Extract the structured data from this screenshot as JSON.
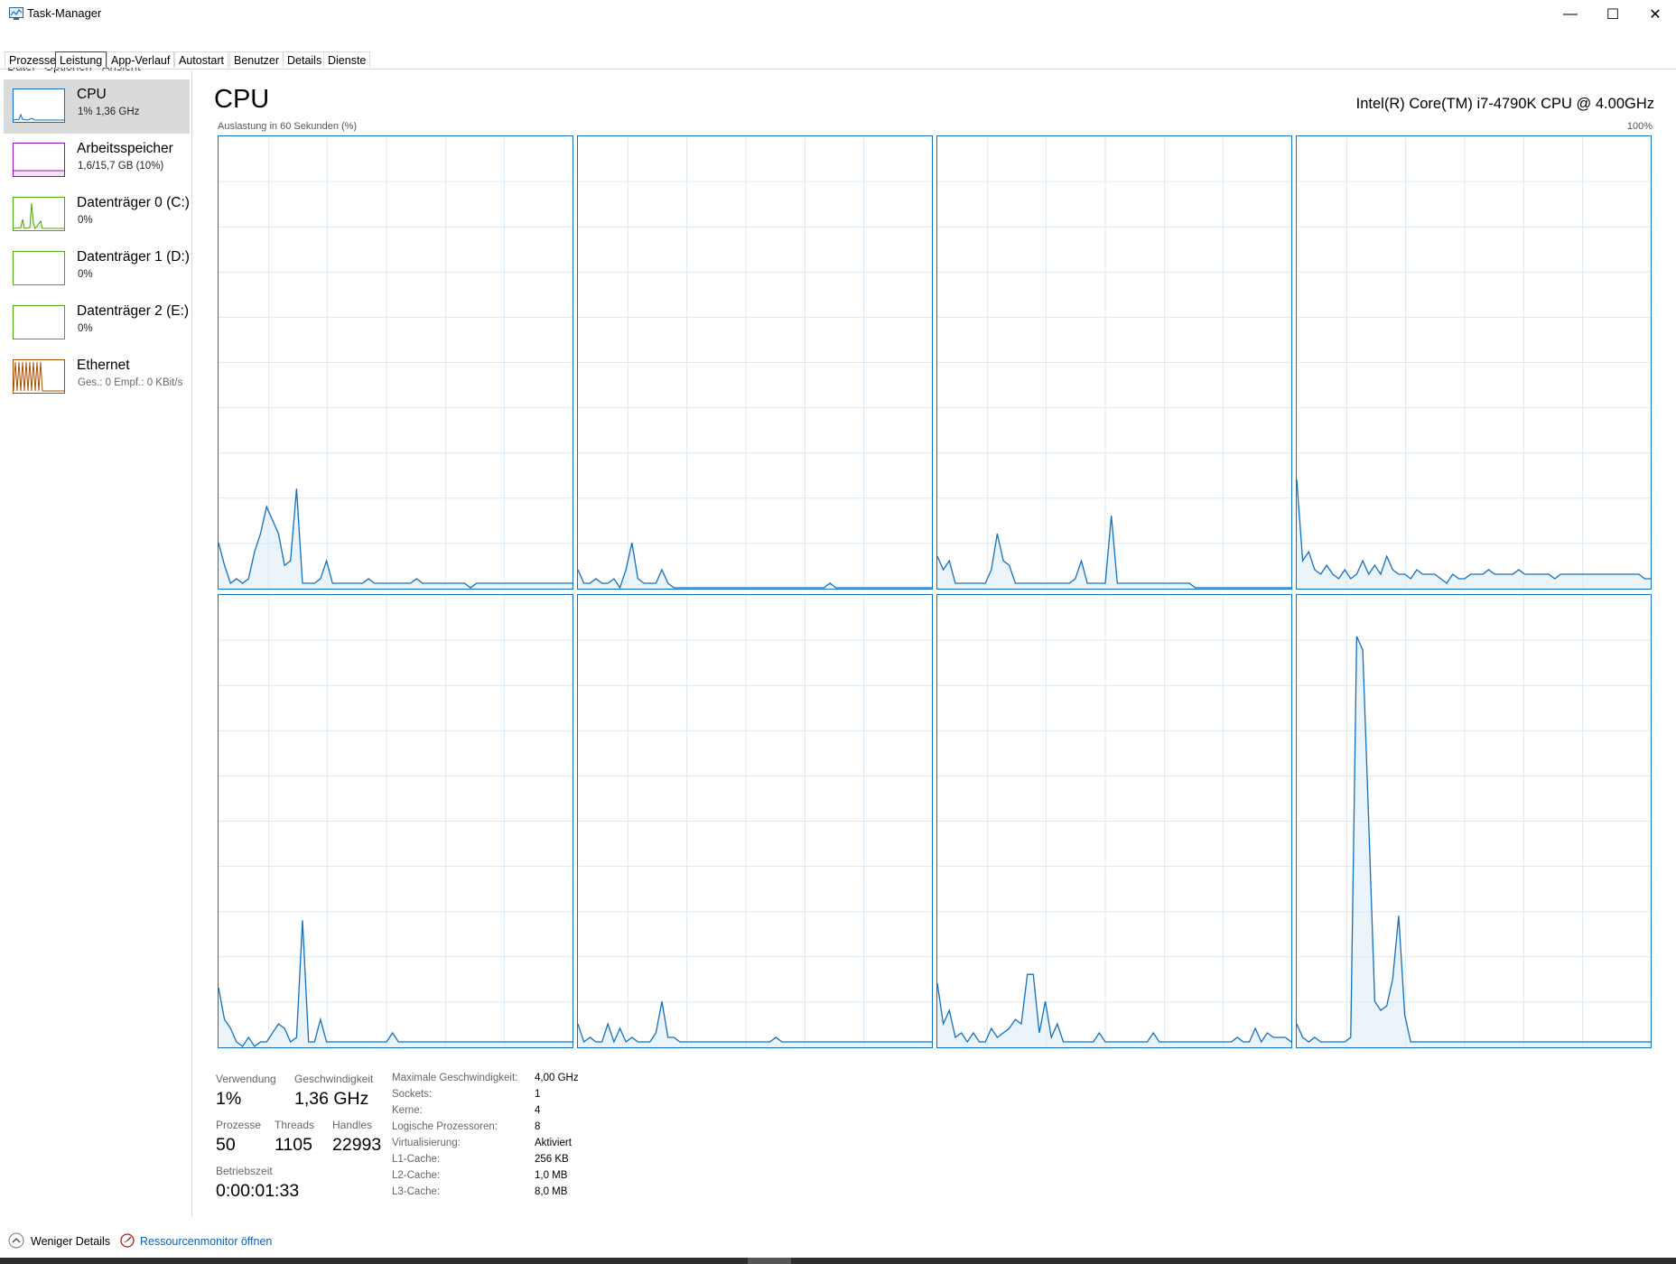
{
  "window": {
    "title": "Task-Manager",
    "minimize": "—",
    "maximize": "☐",
    "close": "✕"
  },
  "menu": [
    "Datei",
    "Optionen",
    "Ansicht"
  ],
  "tabs": [
    {
      "label": "Prozesse",
      "active": false
    },
    {
      "label": "Leistung",
      "active": true
    },
    {
      "label": "App-Verlauf",
      "active": false
    },
    {
      "label": "Autostart",
      "active": false
    },
    {
      "label": "Benutzer",
      "active": false
    },
    {
      "label": "Details",
      "active": false
    },
    {
      "label": "Dienste",
      "active": false
    }
  ],
  "sidebar": {
    "items": [
      {
        "title": "CPU",
        "subtitle": "1%  1,36 GHz",
        "color": "#1170c0",
        "selected": true
      },
      {
        "title": "Arbeitsspeicher",
        "subtitle": "1,6/15,7 GB (10%)",
        "color": "#8b12ae",
        "selected": false
      },
      {
        "title": "Datenträger 0 (C:)",
        "subtitle": "0%",
        "color": "#4da60c",
        "selected": false
      },
      {
        "title": "Datenträger 1 (D:)",
        "subtitle": "0%",
        "color": "#4da60c",
        "selected": false
      },
      {
        "title": "Datenträger 2 (E:)",
        "subtitle": "0%",
        "color": "#4da60c",
        "selected": false
      },
      {
        "title": "Ethernet",
        "subtitle": "Ges.: 0 Empf.: 0 KBit/s",
        "color": "#a74f01",
        "selected": false
      }
    ]
  },
  "main": {
    "title": "CPU",
    "cpu_model": "Intel(R) Core(TM) i7-4790K CPU @ 4.00GHz",
    "graph_label": "Auslastung in 60 Sekunden (%)",
    "graph_max": "100%",
    "accent": "#1170c0",
    "grid_color": "#d9eaf7"
  },
  "chart_data": {
    "type": "area",
    "title": "",
    "xlabel": "",
    "ylabel": "Auslastung in 60 Sekunden (%)",
    "ylim": [
      0,
      100
    ],
    "xlim": [
      0,
      60
    ],
    "grid": true,
    "series": [
      {
        "name": "",
        "values": [
          10,
          5,
          1,
          2,
          1,
          2,
          8,
          12,
          18,
          15,
          12,
          5,
          6,
          22,
          1,
          1,
          1,
          2,
          6,
          1,
          1,
          1,
          1,
          1,
          1,
          2,
          1,
          1,
          1,
          1,
          1,
          1,
          1,
          2,
          1,
          1,
          1,
          1,
          1,
          1,
          1,
          1,
          0,
          1,
          1,
          1,
          1,
          1,
          1,
          1,
          1,
          1,
          1,
          1,
          1,
          1,
          1,
          1,
          1,
          1
        ]
      },
      {
        "name": "",
        "values": [
          4,
          1,
          1,
          2,
          1,
          1,
          2,
          0,
          4,
          10,
          2,
          1,
          1,
          1,
          4,
          1,
          0,
          0,
          0,
          0,
          0,
          0,
          0,
          0,
          0,
          0,
          0,
          0,
          0,
          0,
          0,
          0,
          0,
          0,
          0,
          0,
          0,
          0,
          0,
          0,
          0,
          0,
          1,
          0,
          0,
          0,
          0,
          0,
          0,
          0,
          0,
          0,
          0,
          0,
          0,
          0,
          0,
          0,
          0,
          0
        ]
      },
      {
        "name": "",
        "values": [
          7,
          4,
          6,
          1,
          1,
          1,
          1,
          1,
          1,
          4,
          12,
          6,
          5,
          1,
          1,
          1,
          1,
          1,
          1,
          1,
          1,
          1,
          1,
          2,
          6,
          1,
          1,
          1,
          1,
          16,
          1,
          1,
          1,
          1,
          1,
          1,
          1,
          1,
          1,
          1,
          1,
          1,
          1,
          0,
          0,
          0,
          0,
          0,
          0,
          0,
          0,
          0,
          0,
          0,
          0,
          0,
          0,
          0,
          0,
          0
        ]
      },
      {
        "name": "",
        "values": [
          24,
          6,
          8,
          4,
          3,
          5,
          3,
          2,
          4,
          2,
          3,
          6,
          3,
          5,
          3,
          7,
          4,
          3,
          3,
          2,
          4,
          3,
          3,
          3,
          2,
          1,
          3,
          2,
          2,
          3,
          3,
          3,
          4,
          3,
          3,
          3,
          3,
          4,
          3,
          3,
          3,
          3,
          3,
          2,
          3,
          3,
          3,
          3,
          3,
          3,
          3,
          3,
          3,
          3,
          3,
          3,
          3,
          3,
          2,
          2
        ]
      },
      {
        "name": "",
        "values": [
          13,
          6,
          4,
          1,
          0,
          2,
          0,
          1,
          1,
          3,
          5,
          4,
          1,
          2,
          28,
          1,
          1,
          6,
          1,
          1,
          1,
          1,
          1,
          1,
          1,
          1,
          1,
          1,
          1,
          3,
          1,
          1,
          1,
          1,
          1,
          1,
          1,
          1,
          1,
          1,
          1,
          1,
          1,
          1,
          1,
          1,
          1,
          1,
          1,
          1,
          1,
          1,
          1,
          1,
          1,
          1,
          1,
          1,
          1,
          1
        ]
      },
      {
        "name": "",
        "values": [
          5,
          1,
          2,
          1,
          1,
          5,
          1,
          4,
          1,
          2,
          1,
          1,
          1,
          3,
          10,
          2,
          2,
          1,
          1,
          1,
          1,
          1,
          1,
          1,
          1,
          1,
          1,
          1,
          1,
          1,
          1,
          1,
          1,
          2,
          1,
          1,
          1,
          1,
          1,
          1,
          1,
          1,
          1,
          1,
          1,
          1,
          1,
          1,
          1,
          1,
          1,
          1,
          1,
          1,
          1,
          1,
          1,
          1,
          1,
          1
        ]
      },
      {
        "name": "",
        "values": [
          14,
          5,
          8,
          2,
          3,
          1,
          3,
          1,
          1,
          4,
          2,
          3,
          4,
          6,
          5,
          16,
          16,
          3,
          10,
          2,
          5,
          1,
          1,
          1,
          1,
          1,
          1,
          3,
          1,
          1,
          1,
          1,
          1,
          1,
          1,
          1,
          3,
          1,
          1,
          1,
          1,
          1,
          1,
          1,
          1,
          1,
          1,
          1,
          1,
          1,
          2,
          1,
          1,
          4,
          1,
          3,
          2,
          2,
          2,
          1
        ]
      },
      {
        "name": "",
        "values": [
          5,
          2,
          1,
          2,
          1,
          1,
          1,
          1,
          1,
          2,
          91,
          88,
          50,
          10,
          8,
          9,
          15,
          29,
          7,
          1,
          1,
          1,
          1,
          1,
          1,
          1,
          1,
          1,
          1,
          1,
          1,
          1,
          1,
          1,
          1,
          1,
          1,
          1,
          1,
          1,
          1,
          1,
          1,
          1,
          1,
          1,
          1,
          1,
          1,
          1,
          1,
          1,
          1,
          1,
          1,
          1,
          1,
          1,
          1,
          1
        ]
      }
    ]
  },
  "stats": {
    "usage_label": "Verwendung",
    "usage_value": "1%",
    "speed_label": "Geschwindigkeit",
    "speed_value": "1,36 GHz",
    "processes_label": "Prozesse",
    "processes_value": "50",
    "threads_label": "Threads",
    "threads_value": "1105",
    "handles_label": "Handles",
    "handles_value": "22993",
    "uptime_label": "Betriebszeit",
    "uptime_value": "0:00:01:33"
  },
  "specs": [
    {
      "label": "Maximale Geschwindigkeit:",
      "value": "4,00 GHz"
    },
    {
      "label": "Sockets:",
      "value": "1"
    },
    {
      "label": "Kerne:",
      "value": "4"
    },
    {
      "label": "Logische Prozessoren:",
      "value": "8"
    },
    {
      "label": "Virtualisierung:",
      "value": "Aktiviert"
    },
    {
      "label": "L1-Cache:",
      "value": "256 KB"
    },
    {
      "label": "L2-Cache:",
      "value": "1,0 MB"
    },
    {
      "label": "L3-Cache:",
      "value": "8,0 MB"
    }
  ],
  "footer": {
    "less_details": "Weniger Details",
    "resource_monitor": "Ressourcenmonitor öffnen"
  }
}
